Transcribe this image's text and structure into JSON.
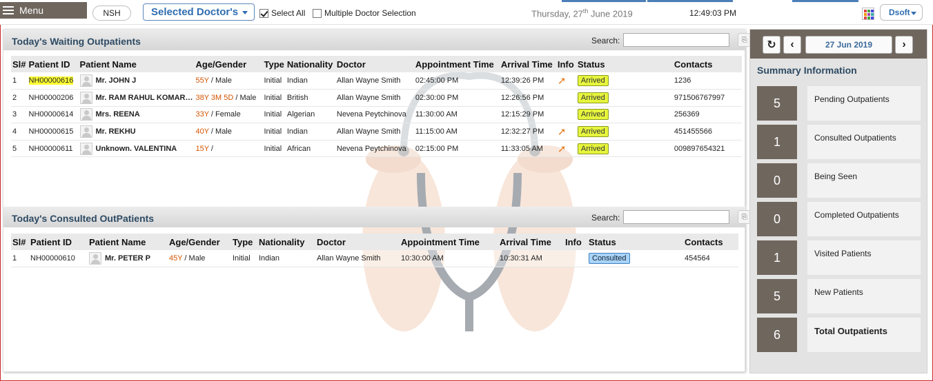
{
  "topbar": {
    "menu_label": "Menu",
    "facility": "NSH",
    "doctor_select": "Selected Doctor's",
    "select_all": "Select All",
    "multiple_doctor": "Multiple Doctor Selection",
    "date_prefix": "Thursday, 27",
    "date_sup": "th",
    "date_suffix": " June 2019",
    "time": "12:49:03 PM",
    "user": "Dsoft"
  },
  "waiting": {
    "title": "Today's Waiting Outpatients",
    "search_label": "Search:",
    "columns": [
      "Sl#",
      "Patient ID",
      "Patient Name",
      "Age/Gender",
      "Type",
      "Nationality",
      "Doctor",
      "Appointment Time",
      "Arrival Time",
      "Info",
      "Status",
      "Contacts"
    ],
    "rows": [
      {
        "sl": "1",
        "id": "NH00000616",
        "name": "Mr. JOHN J",
        "age": "55Y",
        "gender": " / Male",
        "type": "Initial",
        "nationality": "Indian",
        "doctor": "Allan Wayne Smith",
        "appt": "02:45:00 PM",
        "arrival": "12:39:26 PM",
        "info": "➚",
        "status": "Arrived",
        "contact": "1236"
      },
      {
        "sl": "2",
        "id": "NH00000206",
        "name": "Mr. RAM RAHUL KOMAR…",
        "age": "38Y 3M 5D",
        "gender": " / Male",
        "type": "Initial",
        "nationality": "British",
        "doctor": "Allan Wayne Smith",
        "appt": "02:30:00 PM",
        "arrival": "12:26:56 PM",
        "info": "",
        "status": "Arrived",
        "contact": "971506767997"
      },
      {
        "sl": "3",
        "id": "NH00000614",
        "name": "Mrs. REENA",
        "age": "33Y",
        "gender": " / Female",
        "type": "Initial",
        "nationality": "Algerian",
        "doctor": "Nevena Peytchinova",
        "appt": "11:30:00 AM",
        "arrival": "12:15:29 PM",
        "info": "",
        "status": "Arrived",
        "contact": "256369"
      },
      {
        "sl": "4",
        "id": "NH00000615",
        "name": "Mr. REKHU",
        "age": "40Y",
        "gender": " / Male",
        "type": "Initial",
        "nationality": "Indian",
        "doctor": "Allan Wayne Smith",
        "appt": "11:15:00 AM",
        "arrival": "12:32:27 PM",
        "info": "➚",
        "status": "Arrived",
        "contact": "451455566"
      },
      {
        "sl": "5",
        "id": "NH00000611",
        "name": "Unknown. VALENTINA",
        "age": "15Y",
        "gender": " /",
        "type": "Initial",
        "nationality": "African",
        "doctor": "Nevena Peytchinova",
        "appt": "02:15:00 PM",
        "arrival": "11:33:05 AM",
        "info": "➚",
        "status": "Arrived",
        "contact": "009897654321"
      }
    ]
  },
  "consulted": {
    "title": "Today's Consulted OutPatients",
    "search_label": "Search:",
    "columns": [
      "Sl#",
      "Patient ID",
      "Patient Name",
      "Age/Gender",
      "Type",
      "Nationality",
      "Doctor",
      "Appointment Time",
      "Arrival Time",
      "Info",
      "Status",
      "Contacts"
    ],
    "rows": [
      {
        "sl": "1",
        "id": "NH00000610",
        "name": "Mr. PETER P",
        "age": "45Y",
        "gender": " / Male",
        "type": "Initial",
        "nationality": "Indian",
        "doctor": "Allan Wayne Smith",
        "appt": "10:30:00 AM",
        "arrival": "10:30:31 AM",
        "info": "",
        "status": "Consulted",
        "contact": "454564"
      }
    ]
  },
  "summary": {
    "date": "27 Jun 2019",
    "title": "Summary Information",
    "items": [
      {
        "count": "5",
        "label": "Pending Outpatients"
      },
      {
        "count": "1",
        "label": "Consulted Outpatients"
      },
      {
        "count": "0",
        "label": "Being Seen"
      },
      {
        "count": "0",
        "label": "Completed Outpatients"
      },
      {
        "count": "1",
        "label": "Visited Patients"
      },
      {
        "count": "5",
        "label": "New Patients"
      },
      {
        "count": "6",
        "label": "Total Outpatients"
      }
    ]
  },
  "colors": {
    "accent": "#2e6db0",
    "menu_bg": "#6f665e",
    "arrived": "#e6f53d",
    "consulted": "#a9d3f7",
    "highlight": "#ffff33"
  },
  "icons": [
    "hamburger-icon",
    "caret-down-icon",
    "app-grid-icon",
    "refresh-icon",
    "chevron-left-icon",
    "chevron-right-icon",
    "info-arrow-icon",
    "avatar-icon",
    "search-tool-icon"
  ]
}
